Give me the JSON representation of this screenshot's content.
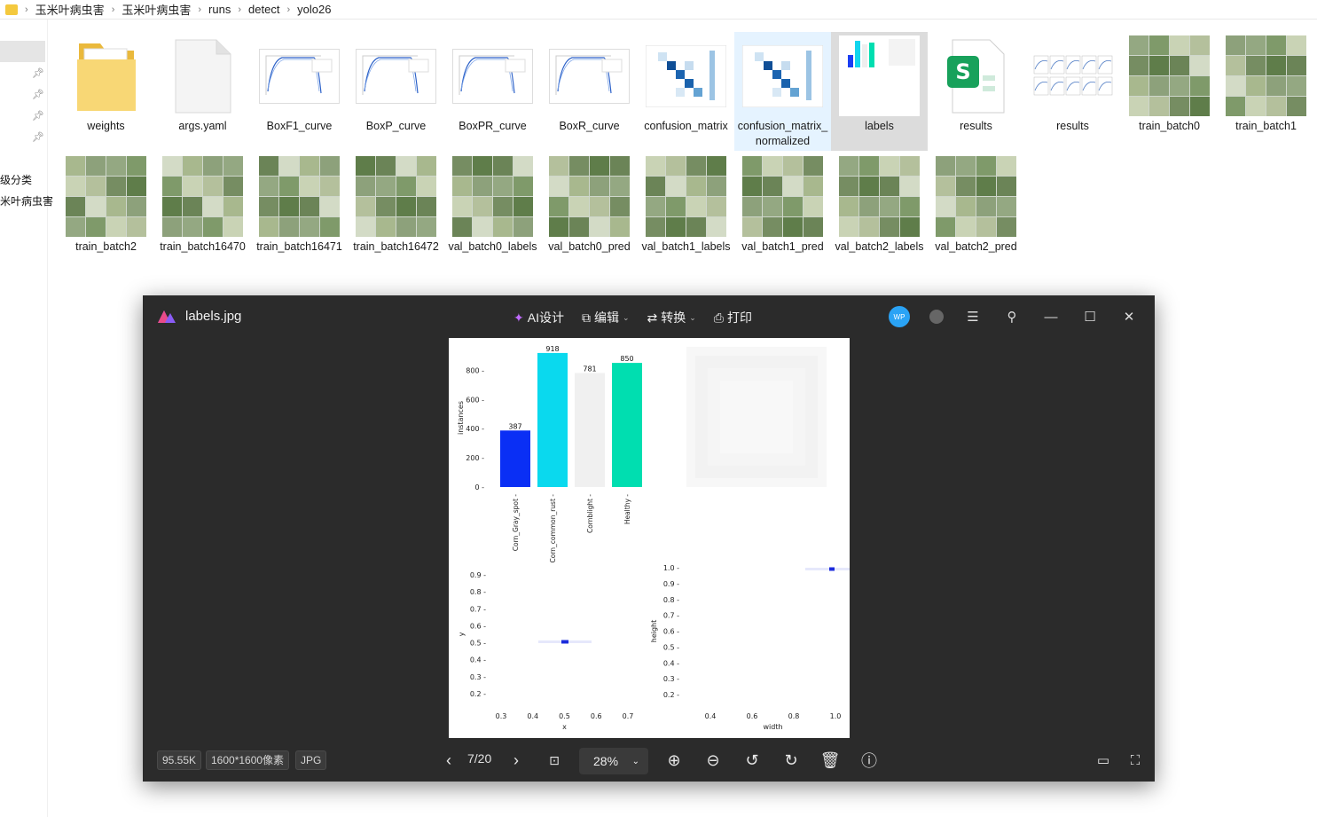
{
  "breadcrumb": [
    "玉米叶病虫害",
    "玉米叶病虫害",
    "runs",
    "detect",
    "yolo26"
  ],
  "nav": {
    "item1": "级分类",
    "item2": "米叶病虫害"
  },
  "files": [
    {
      "name": "weights",
      "kind": "folder"
    },
    {
      "name": "args.yaml",
      "kind": "doc"
    },
    {
      "name": "BoxF1_curve",
      "kind": "curve"
    },
    {
      "name": "BoxP_curve",
      "kind": "curve"
    },
    {
      "name": "BoxPR_curve",
      "kind": "curve"
    },
    {
      "name": "BoxR_curve",
      "kind": "curve"
    },
    {
      "name": "confusion_matrix",
      "kind": "matrix"
    },
    {
      "name": "confusion_matrix_normalized",
      "kind": "matrix"
    },
    {
      "name": "labels",
      "kind": "labels"
    },
    {
      "name": "results",
      "kind": "sheet"
    },
    {
      "name": "results",
      "kind": "plots"
    },
    {
      "name": "train_batch0",
      "kind": "mosaic"
    },
    {
      "name": "train_batch1",
      "kind": "mosaic"
    },
    {
      "name": "train_batch2",
      "kind": "mosaic"
    },
    {
      "name": "train_batch16470",
      "kind": "mosaic"
    },
    {
      "name": "train_batch16471",
      "kind": "mosaic"
    },
    {
      "name": "train_batch16472",
      "kind": "mosaic"
    },
    {
      "name": "val_batch0_labels",
      "kind": "mosaic"
    },
    {
      "name": "val_batch0_pred",
      "kind": "mosaic"
    },
    {
      "name": "val_batch1_labels",
      "kind": "mosaic"
    },
    {
      "name": "val_batch1_pred",
      "kind": "mosaic"
    },
    {
      "name": "val_batch2_labels",
      "kind": "mosaic"
    },
    {
      "name": "val_batch2_pred",
      "kind": "mosaic"
    }
  ],
  "viewer": {
    "filename": "labels.jpg",
    "menu": {
      "ai": "AI设计",
      "edit": "编辑",
      "convert": "转换",
      "print": "打印"
    },
    "avatar": "WP",
    "filesize": "95.55K",
    "dimensions": "1600*1600像素",
    "format": "JPG",
    "page": "7/20",
    "zoom": "28%"
  },
  "chart_data": [
    {
      "type": "bar",
      "categories": [
        "Corn_Gray_spot",
        "Corn_common_rust",
        "Cornblight",
        "Healthy"
      ],
      "values": [
        387,
        918,
        781,
        850
      ],
      "colors": [
        "#0a2ff5",
        "#0ad9ee",
        "#f0f0f0",
        "#00deb0"
      ],
      "ylabel": "instances",
      "yticks": [
        0,
        200,
        400,
        600,
        800
      ],
      "ylim": [
        0,
        960
      ]
    },
    {
      "type": "heatmap",
      "xlabel": "x",
      "ylabel": "y",
      "xticks": [
        "0.3",
        "0.4",
        "0.5",
        "0.6",
        "0.7"
      ],
      "yticks": [
        "0.9",
        "0.8",
        "0.7",
        "0.6",
        "0.5",
        "0.4",
        "0.3",
        "0.2"
      ],
      "hotspot": {
        "x": 0.5,
        "y": 0.5
      }
    },
    {
      "type": "heatmap",
      "xlabel": "width",
      "ylabel": "height",
      "xticks": [
        "0.4",
        "0.6",
        "0.8",
        "1.0"
      ],
      "yticks": [
        "1.0",
        "0.9",
        "0.8",
        "0.7",
        "0.6",
        "0.5",
        "0.4",
        "0.3",
        "0.2"
      ],
      "hotspot": {
        "x": 1.0,
        "y": 1.0
      }
    }
  ]
}
